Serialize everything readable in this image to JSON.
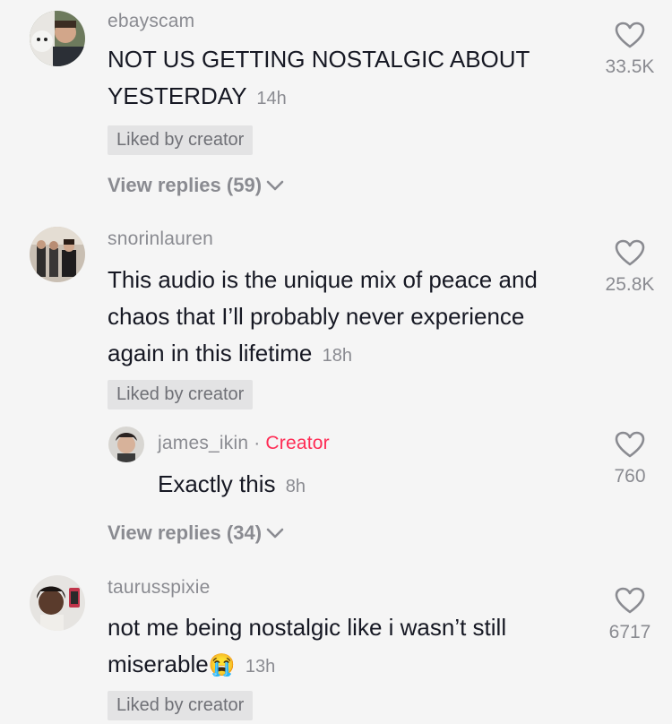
{
  "comments": [
    {
      "username": "ebayscam",
      "text": "NOT US GETTING NOSTALGIC ABOUT YESTERDAY",
      "time": "14h",
      "liked_label": "Liked by creator",
      "likes": "33.5K",
      "view_replies": "View replies (59)"
    },
    {
      "username": "snorinlauren",
      "text": "This audio is the unique mix of peace and chaos that I’ll probably never experience again in this lifetime",
      "time": "18h",
      "liked_label": "Liked by creator",
      "likes": "25.8K",
      "reply": {
        "username": "james_ikin",
        "separator": "·",
        "badge": "Creator",
        "text": "Exactly this",
        "time": "8h",
        "likes": "760"
      },
      "view_replies": "View replies (34)"
    },
    {
      "username": "taurusspixie",
      "text": "not me being nostalgic like i wasn’t still miserable",
      "emoji": "😭",
      "time": "13h",
      "liked_label": "Liked by creator",
      "likes": "6717"
    }
  ],
  "colors": {
    "background": "#f5f5f5",
    "creator_badge": "#fe2c55",
    "muted_text": "#8a8b91"
  }
}
